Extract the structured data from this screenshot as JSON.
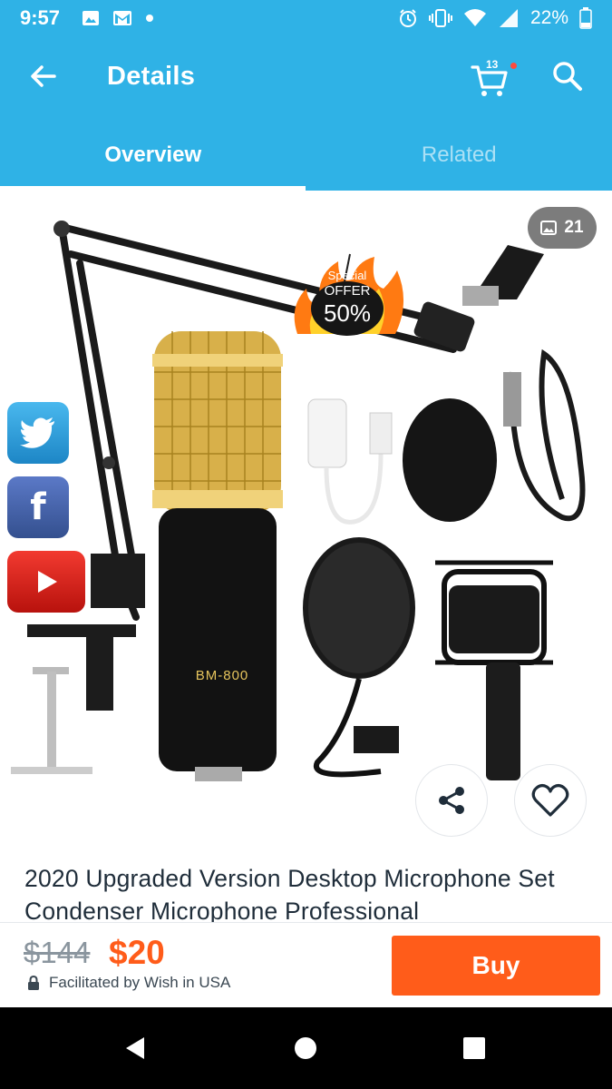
{
  "status_bar": {
    "time": "9:57",
    "battery": "22%",
    "icons": [
      "image-icon",
      "gmail-icon",
      "dot-icon",
      "alarm-icon",
      "vibrate-icon",
      "wifi-icon",
      "signal-icon",
      "battery-icon"
    ]
  },
  "app_bar": {
    "title": "Details",
    "cart_count": "13",
    "icons": [
      "back-arrow-icon",
      "cart-icon",
      "search-icon"
    ]
  },
  "tabs": [
    {
      "label": "Overview",
      "active": true
    },
    {
      "label": "Related",
      "active": false
    }
  ],
  "product_image": {
    "image_count": "21",
    "offer": {
      "line1": "Special",
      "line2": "OFFER",
      "line3": "50%"
    },
    "mic_label": "BM-800",
    "social": [
      "twitter-icon",
      "facebook-icon",
      "youtube-icon"
    ]
  },
  "product": {
    "title": "2020 Upgraded Version Desktop Microphone Set Condenser Microphone Professional"
  },
  "purchase": {
    "old_price": "$144",
    "price": "$20",
    "facilitated": "Facilitated by Wish in USA",
    "buy_label": "Buy"
  },
  "colors": {
    "brand_blue": "#2fb2e6",
    "price_orange": "#ff5c1a",
    "title_text": "#1f2d3a"
  }
}
